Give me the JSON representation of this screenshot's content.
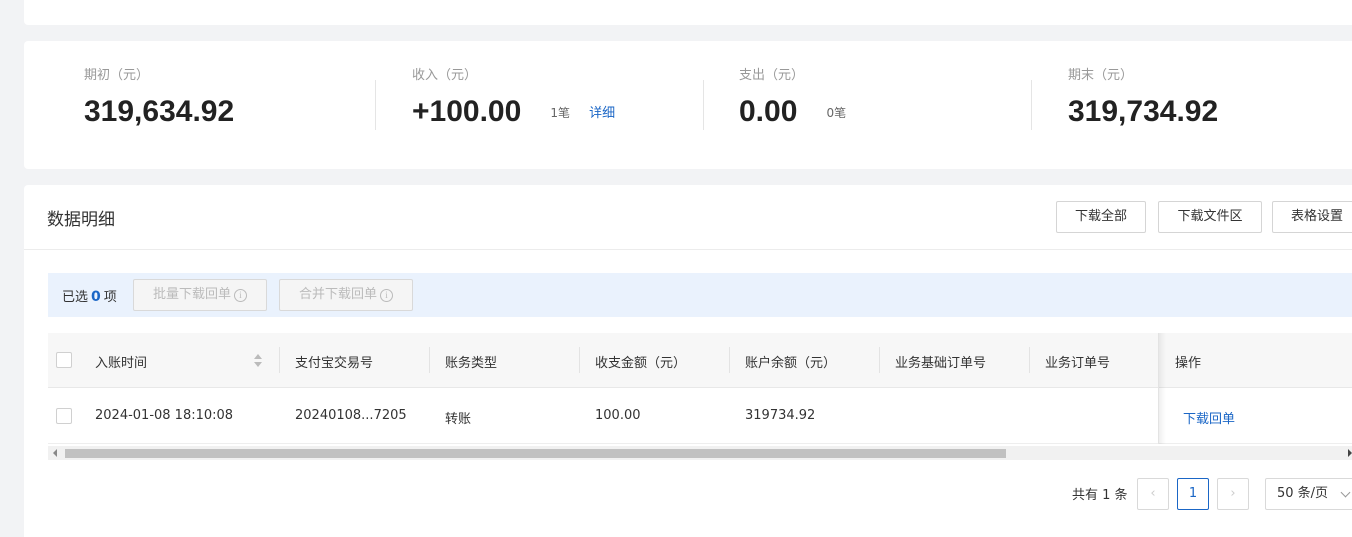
{
  "summary": {
    "opening": {
      "label": "期初（元）",
      "value": "319,634.92"
    },
    "income": {
      "label": "收入（元）",
      "value": "+100.00",
      "count": "1笔",
      "link": "详细"
    },
    "expense": {
      "label": "支出（元）",
      "value": "0.00",
      "count": "0笔"
    },
    "closing": {
      "label": "期末（元）",
      "value": "319,734.92"
    }
  },
  "detail": {
    "title": "数据明细",
    "buttons": {
      "download_all": "下载全部",
      "download_files": "下载文件区",
      "table_settings": "表格设置"
    }
  },
  "selection": {
    "prefix": "已选",
    "count": "0",
    "suffix": "项",
    "batch_download": "批量下载回单",
    "merge_download": "合并下载回单",
    "info_glyph": "i"
  },
  "table": {
    "columns": [
      "入账时间",
      "支付宝交易号",
      "账务类型",
      "收支金额（元）",
      "账户余额（元）",
      "业务基础订单号",
      "业务订单号",
      "操作"
    ],
    "rows": [
      {
        "time": "2024-01-08 18:10:08",
        "trade_no": "20240108...7205",
        "type": "转账",
        "amount": "100.00",
        "balance": "319734.92",
        "base_order": "",
        "order": "",
        "action": "下载回单"
      }
    ]
  },
  "pagination": {
    "total_text": "共有 1 条",
    "prev": "‹",
    "current": "1",
    "next": "›",
    "page_size": "50 条/页"
  },
  "colors": {
    "accent": "#1a66c6",
    "selection_bg": "#eaf2fd",
    "page_bg": "#f2f3f5"
  }
}
